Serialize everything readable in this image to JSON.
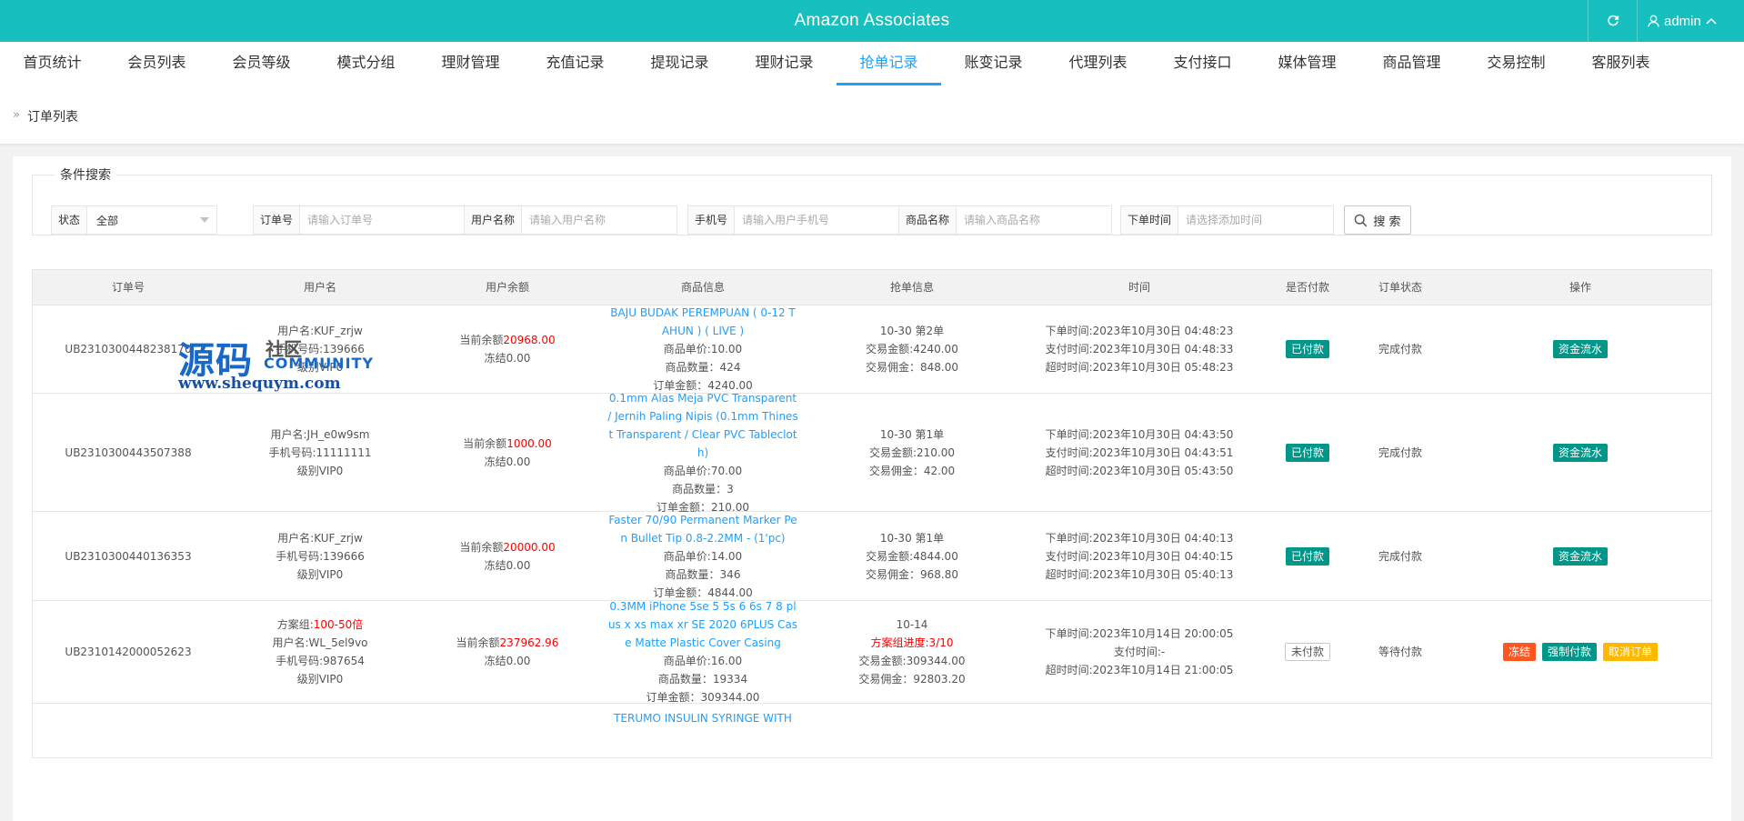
{
  "header": {
    "title": "Amazon Associates",
    "user": "admin"
  },
  "nav": [
    {
      "label": "首页统计",
      "active": false
    },
    {
      "label": "会员列表",
      "active": false
    },
    {
      "label": "会员等级",
      "active": false
    },
    {
      "label": "模式分组",
      "active": false
    },
    {
      "label": "理财管理",
      "active": false
    },
    {
      "label": "充值记录",
      "active": false
    },
    {
      "label": "提现记录",
      "active": false
    },
    {
      "label": "理财记录",
      "active": false
    },
    {
      "label": "抢单记录",
      "active": true
    },
    {
      "label": "账变记录",
      "active": false
    },
    {
      "label": "代理列表",
      "active": false
    },
    {
      "label": "支付接口",
      "active": false
    },
    {
      "label": "媒体管理",
      "active": false
    },
    {
      "label": "商品管理",
      "active": false
    },
    {
      "label": "交易控制",
      "active": false
    },
    {
      "label": "客服列表",
      "active": false
    }
  ],
  "breadcrumb": "订单列表",
  "search": {
    "legend": "条件搜索",
    "status_label": "状态",
    "status_value": "全部",
    "order_label": "订单号",
    "order_placeholder": "请输入订单号",
    "username_label": "用户名称",
    "username_placeholder": "请输入用户名称",
    "phone_label": "手机号",
    "phone_placeholder": "请输入用户手机号",
    "product_label": "商品名称",
    "product_placeholder": "请输入商品名称",
    "time_label": "下单时间",
    "time_placeholder": "请选择添加时间",
    "button": "搜 索"
  },
  "table": {
    "headers": [
      "订单号",
      "用户名",
      "用户余额",
      "商品信息",
      "抢单信息",
      "时间",
      "是否付款",
      "订单状态",
      "操作"
    ],
    "rows": [
      {
        "order_no": "UB2310300448238170",
        "user_lines": [
          "用户名:KUF_zrjw",
          "手机号码:139666",
          "级别VIP0"
        ],
        "balance_prefix": "当前余额",
        "balance": "20968.00",
        "frozen": "冻结0.00",
        "product_name": "BAJU BUDAK PEREMPUAN ( 0-12 TAHUN ) ( LIVE )",
        "product_lines": [
          "商品单价:10.00",
          "商品数量：424",
          "订单金额：4240.00"
        ],
        "grab_lines": [
          "10-30 第2单",
          "交易金额:4240.00",
          "交易佣金：848.00"
        ],
        "time_lines": [
          "下单时间:2023年10月30日 04:48:23",
          "支付时间:2023年10月30日 04:48:33",
          "超时时间:2023年10月30日 05:48:23"
        ],
        "paid": "已付款",
        "status": "完成付款",
        "ops": [
          "资金流水"
        ]
      },
      {
        "order_no": "UB2310300443507388",
        "user_lines": [
          "用户名:JH_e0w9sm",
          "手机号码:11111111",
          "级别VIP0"
        ],
        "balance_prefix": "当前余额",
        "balance": "1000.00",
        "frozen": "冻结0.00",
        "product_name": "0.1mm Alas Meja PVC Transparent / Jernih Paling Nipis (0.1mm Thinest Transparent / Clear PVC Tablecloth)",
        "product_lines": [
          "商品单价:70.00",
          "商品数量：3",
          "订单金额：210.00"
        ],
        "grab_lines": [
          "10-30 第1单",
          "交易金额:210.00",
          "交易佣金：42.00"
        ],
        "time_lines": [
          "下单时间:2023年10月30日 04:43:50",
          "支付时间:2023年10月30日 04:43:51",
          "超时时间:2023年10月30日 05:43:50"
        ],
        "paid": "已付款",
        "status": "完成付款",
        "ops": [
          "资金流水"
        ]
      },
      {
        "order_no": "UB2310300440136353",
        "user_lines": [
          "用户名:KUF_zrjw",
          "手机号码:139666",
          "级别VIP0"
        ],
        "balance_prefix": "当前余额",
        "balance": "20000.00",
        "frozen": "冻结0.00",
        "product_name": "Faster 70/90 Permanent Marker Pen Bullet Tip 0.8-2.2MM - (1'pc)",
        "product_lines": [
          "商品单价:14.00",
          "商品数量：346",
          "订单金额：4844.00"
        ],
        "grab_lines": [
          "10-30 第1单",
          "交易金额:4844.00",
          "交易佣金：968.80"
        ],
        "time_lines": [
          "下单时间:2023年10月30日 04:40:13",
          "支付时间:2023年10月30日 04:40:15",
          "超时时间:2023年10月30日 05:40:13"
        ],
        "paid": "已付款",
        "status": "完成付款",
        "ops": [
          "资金流水"
        ]
      },
      {
        "order_no": "UB2310142000052623",
        "scheme_prefix": "方案组:",
        "scheme": "100-50倍",
        "user_lines": [
          "用户名:WL_5el9vo",
          "手机号码:987654",
          "级别VIP0"
        ],
        "balance_prefix": "当前余额",
        "balance": "237962.96",
        "frozen": "冻结0.00",
        "product_name": "0.3MM iPhone 5se 5 5s 6 6s 7 8 plus x xs max xr SE 2020 6PLUS Case Matte Plastic Cover Casing",
        "product_lines": [
          "商品单价:16.00",
          "商品数量：19334",
          "订单金额：309344.00"
        ],
        "grab_lines": [
          "10-14",
          "方案组进度:3/10",
          "交易金额:309344.00",
          "交易佣金：92803.20"
        ],
        "time_lines": [
          "下单时间:2023年10月14日 20:00:05",
          "支付时间:-",
          "超时时间:2023年10月14日 21:00:05"
        ],
        "paid": "未付款",
        "status": "等待付款",
        "ops": [
          "冻结",
          "强制付款",
          "取消订单"
        ]
      },
      {
        "product_name": "TERUMO INSULIN SYRINGE WITH"
      }
    ]
  },
  "watermark": {
    "big": "源码",
    "small": "社区",
    "community": "COMMUNITY",
    "url": "www.shequym.com"
  },
  "colors": {
    "topbar": "#18bfbf",
    "active": "#1e9fff",
    "paid": "#009688",
    "danger": "#ff5722",
    "warning": "#ffb800"
  }
}
